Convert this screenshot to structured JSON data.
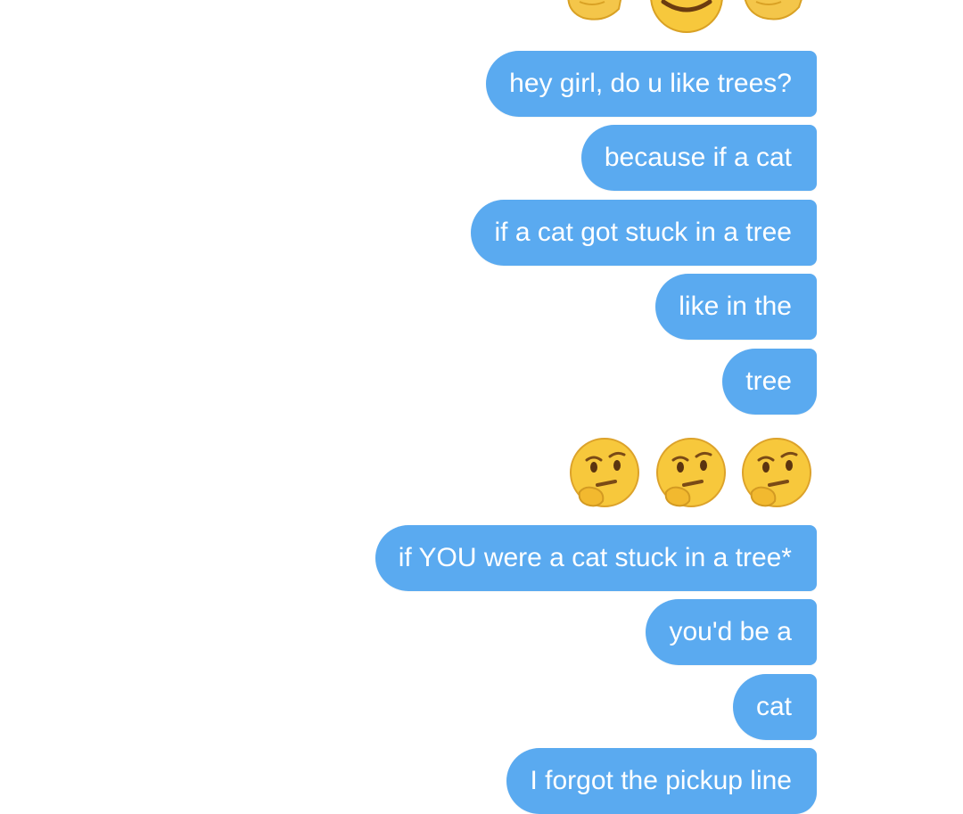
{
  "conversation": {
    "messages": [
      "hey girl, do u like trees?",
      "because if a cat",
      "if a cat got stuck in a tree",
      "like in the",
      "tree",
      "if YOU were a cat stuck in a tree*",
      "you'd be a",
      "cat",
      "I forgot the pickup line"
    ],
    "top_emoji": [
      "flexed-arm-icon",
      "smiling-face-with-sunglasses-icon",
      "flexed-arm-icon"
    ],
    "reaction_emoji": [
      "thinking-face-icon",
      "thinking-face-icon",
      "thinking-face-icon"
    ],
    "bubble_color": "#5aaaf0",
    "text_color": "#ffffff",
    "emoji_color": "#f7c83c"
  }
}
